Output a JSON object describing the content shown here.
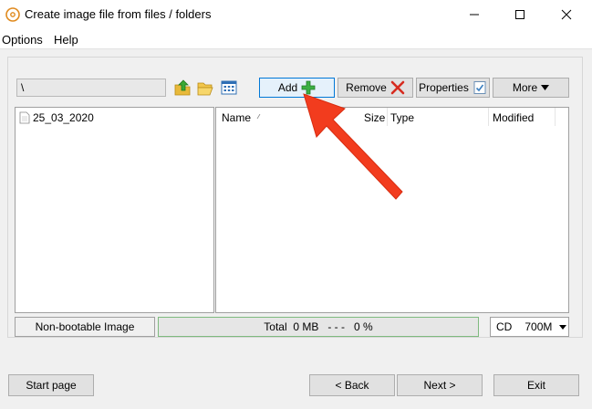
{
  "window": {
    "title": "Create image file from files / folders",
    "icon": "disc-icon",
    "controls": [
      "minimize",
      "maximize",
      "close"
    ]
  },
  "menu": {
    "items": [
      "Options",
      "Help"
    ]
  },
  "toolbar": {
    "path_value": "\\",
    "icons": [
      "folder-up-icon",
      "open-folder-icon",
      "view-icon"
    ],
    "add_label": "Add",
    "remove_label": "Remove",
    "properties_label": "Properties",
    "more_label": "More"
  },
  "tree": {
    "items": [
      {
        "label": "25_03_2020",
        "icon": "file-icon"
      }
    ]
  },
  "file_list": {
    "columns": [
      "Name",
      "Size",
      "Type",
      "Modified"
    ],
    "rows": []
  },
  "status": {
    "image_type": "Non-bootable Image",
    "total_label": "Total",
    "total_value": "0 MB",
    "separator": "- - -",
    "percent": "0 %",
    "progress_fraction": 0,
    "media": "CD",
    "capacity": "700M"
  },
  "footer": {
    "start_page_label": "Start page",
    "back_label": "< Back",
    "next_label": "Next >",
    "exit_label": "Exit"
  },
  "colors": {
    "accent": "#0078d7",
    "annotation_arrow": "#f23c1e",
    "add_icon": "#3cb043",
    "remove_icon": "#d62b1f"
  }
}
